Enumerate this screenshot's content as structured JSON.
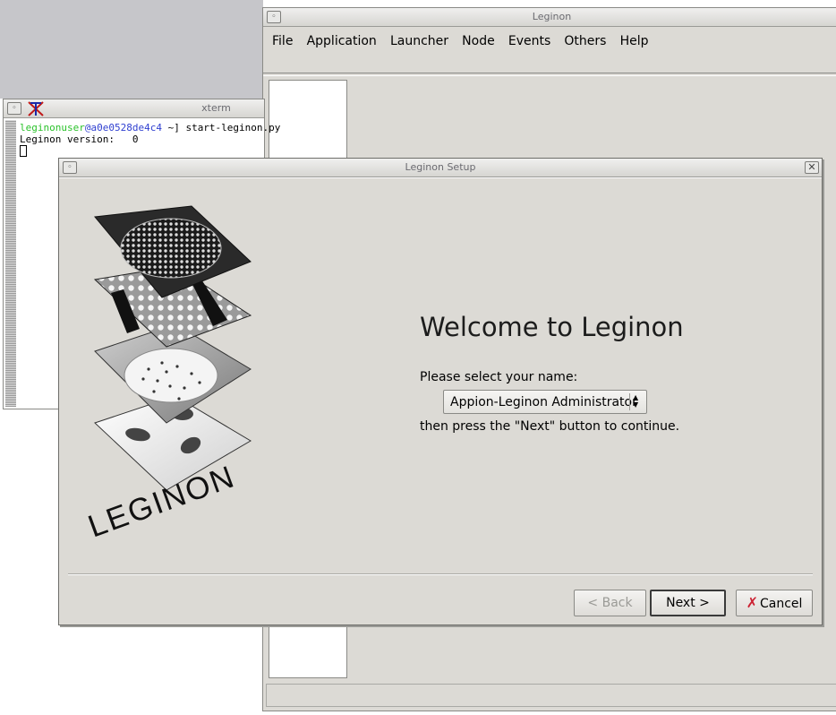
{
  "leginon_window": {
    "title": "Leginon",
    "menu": [
      "File",
      "Application",
      "Launcher",
      "Node",
      "Events",
      "Others",
      "Help"
    ]
  },
  "xterm": {
    "title": "xterm",
    "prompt_user": "leginonuser",
    "prompt_host": "@a0e0528de4c4",
    "prompt_cmd": " ~] start-leginon.py",
    "version_line": "Leginon version:   0"
  },
  "dialog": {
    "title": "Leginon Setup",
    "welcome": "Welcome to Leginon",
    "prompt": "Please select your name:",
    "selected_name": "Appion-Leginon Administrator",
    "hint": "then press the \"Next\" button to continue.",
    "logo_text": "LEGINON",
    "buttons": {
      "back": "< Back",
      "next": "Next >",
      "cancel": "Cancel"
    }
  },
  "icons": {
    "close": "close-icon",
    "menu": "window-menu-icon",
    "cancel": "cancel-x-icon",
    "xterm": "x-logo-icon",
    "select_arrows": "up-down-arrows-icon"
  }
}
